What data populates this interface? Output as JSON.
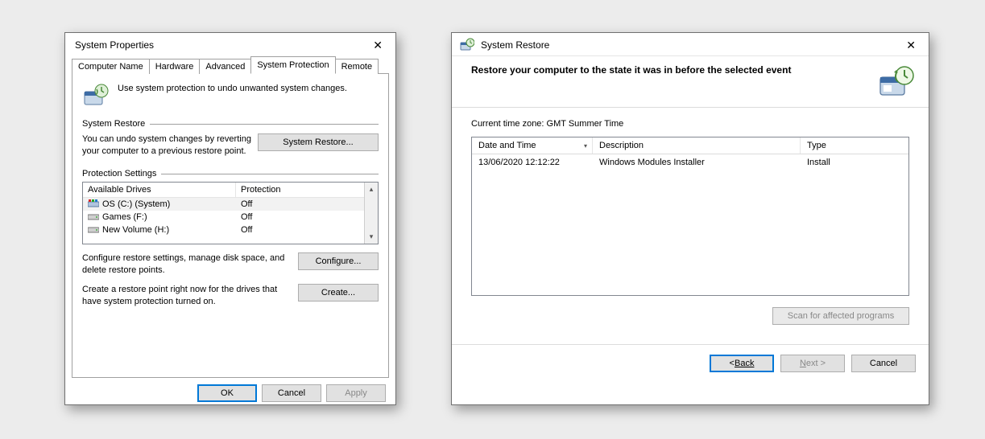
{
  "win1": {
    "title": "System Properties",
    "tabs": [
      "Computer Name",
      "Hardware",
      "Advanced",
      "System Protection",
      "Remote"
    ],
    "active_tab_index": 3,
    "intro": "Use system protection to undo unwanted system changes.",
    "restore_group": "System Restore",
    "restore_text": "You can undo system changes by reverting your computer to a previous restore point.",
    "restore_btn": "System Restore...",
    "settings_group": "Protection Settings",
    "drive_cols": {
      "c1": "Available Drives",
      "c2": "Protection"
    },
    "drives": [
      {
        "name": "OS (C:) (System)",
        "protection": "Off"
      },
      {
        "name": "Games (F:)",
        "protection": "Off"
      },
      {
        "name": "New Volume (H:)",
        "protection": "Off"
      }
    ],
    "configure_text": "Configure restore settings, manage disk space, and delete restore points.",
    "configure_btn": "Configure...",
    "create_text": "Create a restore point right now for the drives that have system protection turned on.",
    "create_btn": "Create...",
    "ok": "OK",
    "cancel": "Cancel",
    "apply": "Apply"
  },
  "win2": {
    "title": "System Restore",
    "header": "Restore your computer to the state it was in before the selected event",
    "timezone": "Current time zone: GMT Summer Time",
    "cols": {
      "c1": "Date and Time",
      "c2": "Description",
      "c3": "Type"
    },
    "rows": [
      {
        "dt": "13/06/2020 12:12:22",
        "desc": "Windows Modules Installer",
        "type": "Install"
      }
    ],
    "scan": "Scan for affected programs",
    "back": "Back",
    "next": "Next >",
    "cancel": "Cancel"
  }
}
